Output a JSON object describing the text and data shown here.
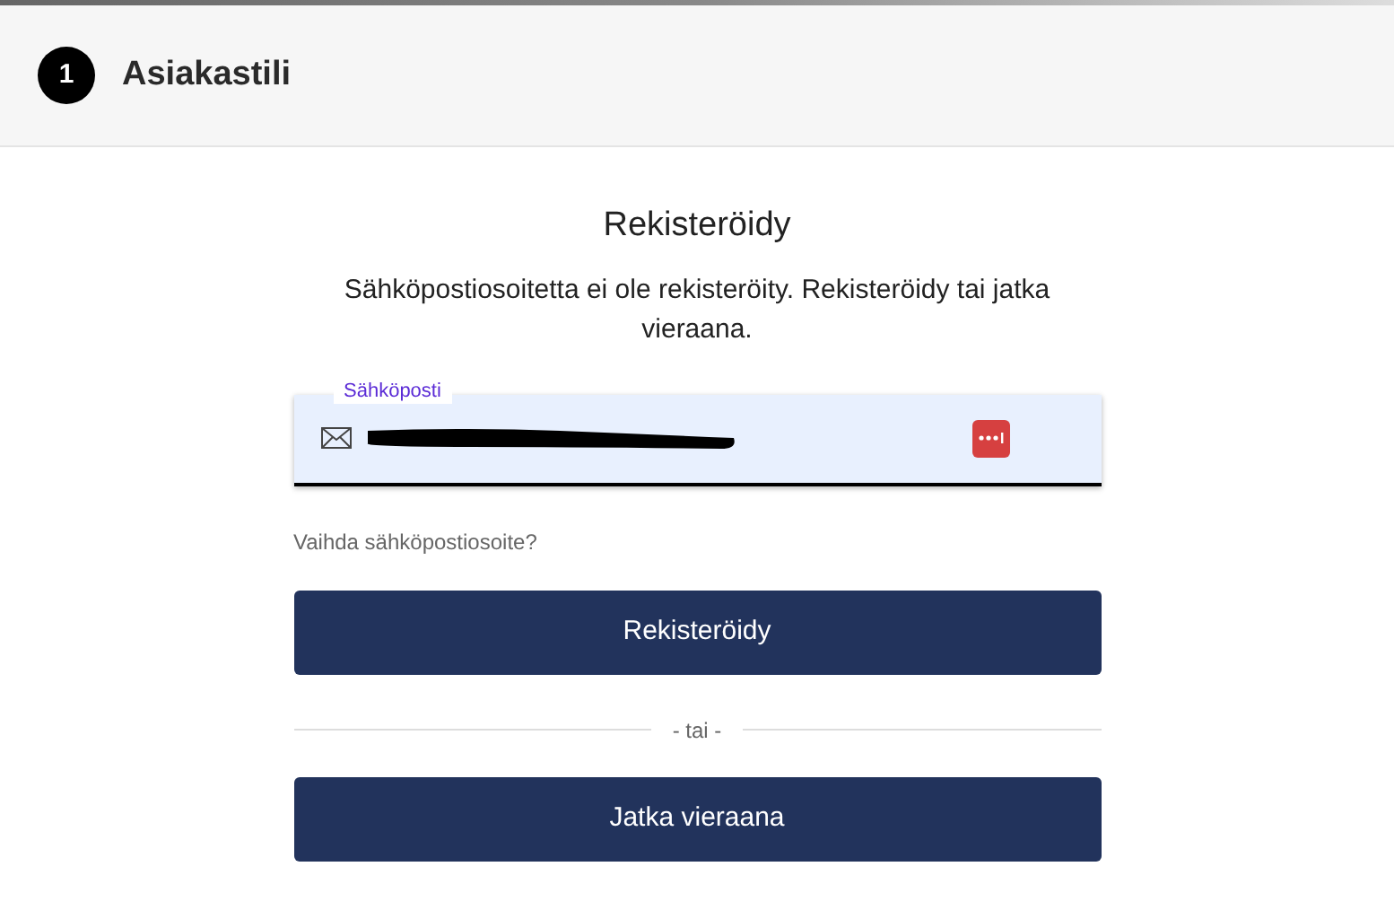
{
  "header": {
    "step": "1",
    "title": "Asiakastili"
  },
  "heading": "Rekisteröidy",
  "message": "Sähköpostiosoitetta ei ole rekisteröity. Rekisteröidy tai jatka vieraana.",
  "email_field": {
    "label": "Sähköposti",
    "value_redacted": true
  },
  "change_email_link": "Vaihda sähköpostiosoite?",
  "register_button": "Rekisteröidy",
  "divider": "- tai -",
  "guest_button": "Jatka vieraana"
}
